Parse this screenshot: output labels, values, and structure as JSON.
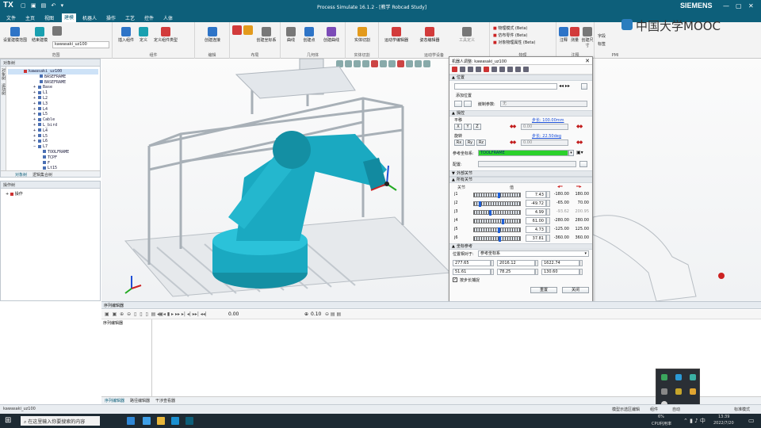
{
  "app": {
    "logo": "TX",
    "window_title": "Process Simulate 16.1.2 - [教学 Robcad Study]",
    "brand": "SIEMENS",
    "watermark": "中国大学MOOC"
  },
  "menu": [
    "文件",
    "主页",
    "视图",
    "建模",
    "机器人",
    "操作",
    "工艺",
    "控件",
    "人体"
  ],
  "menu_active_index": 3,
  "ribbon": {
    "groups": [
      {
        "label": "范围",
        "buttons": [
          "设置建模范围",
          "结束建模",
          "kawasaki_uz100"
        ]
      },
      {
        "label": "组件",
        "buttons": [
          "插入组件",
          "定义",
          "定义组件类型"
        ]
      },
      {
        "label": "编辑",
        "buttons": [
          "创建连接"
        ]
      },
      {
        "label": "布局",
        "buttons": [
          "创建坐标系"
        ]
      },
      {
        "label": "几何体",
        "buttons": [
          "曲线",
          "创建点",
          "创建曲线"
        ]
      },
      {
        "label": "实体切割",
        "buttons": [
          "实体切割"
        ]
      },
      {
        "label": "运动学设备",
        "buttons": [
          "运动学编辑器",
          "姿态编辑器",
          "工具定义"
        ]
      },
      {
        "label": "物理",
        "buttons": [
          "物理模式 (Beta)",
          "仿布零件 (Beta)",
          "对象物理属性 (Beta)"
        ]
      },
      {
        "label": "注释",
        "buttons": [
          "注释",
          "测量",
          "创建尺寸"
        ]
      },
      {
        "label": "PMI",
        "buttons": [
          "字段",
          "标签"
        ]
      }
    ],
    "scope_value": "kawasaki_uz100"
  },
  "object_tree": {
    "title": "对象树",
    "side_tabs": [
      "对象树",
      "运动树"
    ],
    "rows": [
      "kawasaki_uz100",
      "BASEFRAME",
      "BASEFRAME",
      "Base",
      "L1",
      "L2",
      "L3",
      "L4",
      "L5",
      "Cable",
      "L_bird",
      "L4",
      "L5",
      "L6",
      "L7",
      "TOOLFRAME",
      "TCPF",
      "F",
      "Lt15"
    ],
    "selected_index": 0,
    "bottom_tabs": [
      "对象树",
      "逻辑集合树"
    ]
  },
  "operation_tree": {
    "title": "操作树",
    "rows": [
      "操作"
    ]
  },
  "sequence_editor": {
    "title": "序列编辑器",
    "left_label": "序列编辑器",
    "time_start": "0.00",
    "time_step": "0.10",
    "tabs": [
      "序列编辑器",
      "路径编辑器",
      "干涉查看器"
    ]
  },
  "status_bar": {
    "left": "kawasaki_uz100",
    "right_items": [
      "模型示选区编辑",
      "组件",
      "自动",
      "标准模式"
    ]
  },
  "taskbar": {
    "search_placeholder": "在这里输入你要搜索的内容",
    "cpu": "6%",
    "cpu_label": "CPU利用率",
    "time": "13:39",
    "date": "2022/7/20"
  },
  "dialog": {
    "title": "机器人调整: kawasaki_uz100",
    "sections": {
      "position": "位置",
      "manipulation": "操控",
      "external_axes": "外部关节",
      "all_joints": "所有关节",
      "coordinate_ref": "坐标参考"
    },
    "position": {
      "add_position_label": "添加位置",
      "ref_param_label": "嵌制参数:",
      "ref_param_value": "无"
    },
    "manipulation": {
      "translate_label": "平移",
      "step_translate": "步长: 100.00mm",
      "translate_value": "0.00",
      "rotate_label": "旋转",
      "step_rotate": "步长: 22.50deg",
      "rotate_value": "0.00",
      "axes_t": [
        "X",
        "Y",
        "Z"
      ],
      "axes_r": [
        "Rx",
        "Ry",
        "Rz"
      ],
      "ref_frame_label": "参考坐标系:",
      "ref_frame_value": "TOOLFRAME",
      "config_label": "配置:"
    },
    "joints": {
      "col_joint": "关节",
      "col_value": "值",
      "rows": [
        {
          "name": "j1",
          "value": "7.43",
          "lo": "-180.00",
          "hi": "180.00",
          "pos": 0.52
        },
        {
          "name": "j2",
          "value": "-49.72",
          "lo": "-65.00",
          "hi": "70.00",
          "pos": 0.11
        },
        {
          "name": "j3",
          "value": "4.99",
          "lo": "-93.62",
          "hi": "200.95",
          "pos": 0.33
        },
        {
          "name": "j4",
          "value": "61.00",
          "lo": "-280.00",
          "hi": "280.00",
          "pos": 0.61
        },
        {
          "name": "j5",
          "value": "4.73",
          "lo": "-125.00",
          "hi": "125.00",
          "pos": 0.52
        },
        {
          "name": "j6",
          "value": "37.81",
          "lo": "-360.00",
          "hi": "360.00",
          "pos": 0.55
        }
      ]
    },
    "coord_ref": {
      "label": "位置相对于:",
      "value": "参考坐标系",
      "xyz": [
        "277.65",
        "2016.12",
        "1622.74"
      ],
      "rpy": [
        "51.61",
        "78.25",
        "130.60"
      ],
      "follow_label": "按步长捕捉"
    },
    "buttons": {
      "reset": "重置",
      "close": "关闭"
    }
  },
  "tray_popup": {
    "icons": [
      "network-icon",
      "chat-icon",
      "security-icon",
      "pen-icon",
      "media-icon",
      "folder-icon",
      "record-icon"
    ]
  },
  "colors": {
    "titlebar": "#0d5f7a",
    "robot": "#1aa9c1",
    "green_field": "#2bd12b"
  }
}
